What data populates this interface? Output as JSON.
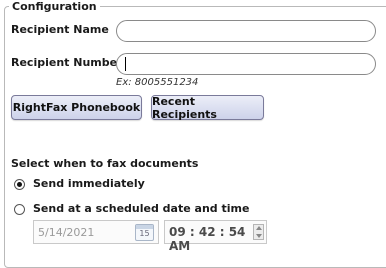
{
  "configuration": {
    "title": "Configuration",
    "recipient_name": {
      "label": "Recipient Name",
      "value": ""
    },
    "recipient_number": {
      "label": "Recipient Number",
      "value": "",
      "hint": "Ex: 8005551234"
    },
    "buttons": {
      "phonebook": "RightFax Phonebook",
      "recent": "Recent Recipients"
    },
    "schedule": {
      "heading": "Select when to fax documents",
      "option_immediately": "Send immediately",
      "option_scheduled": "Send at a scheduled date and time",
      "selected": "immediately",
      "date": "5/14/2021",
      "calendar_day": "15",
      "time": "09 : 42 : 54 AM"
    }
  }
}
